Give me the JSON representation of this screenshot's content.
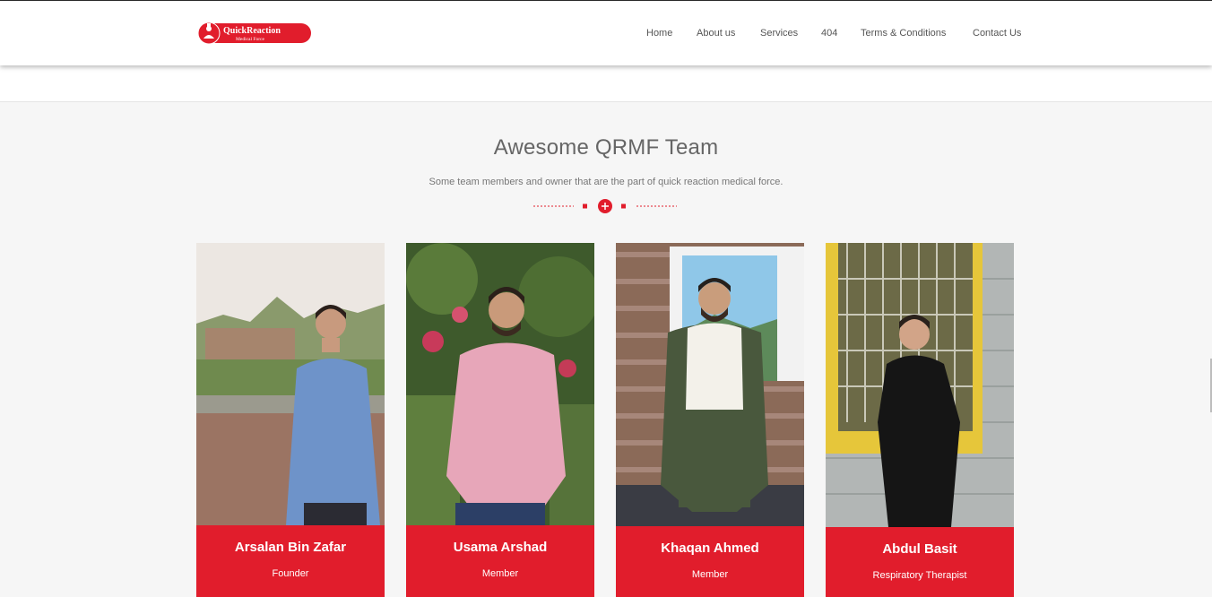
{
  "brand": {
    "logo_text_top": "QuickReaction",
    "logo_text_bottom": "Medical Force",
    "logo_icon": "medical-cross-people-icon",
    "accent": "#e11d2c"
  },
  "nav": {
    "items": [
      {
        "label": "Home"
      },
      {
        "label": "About us"
      },
      {
        "label": "Services"
      },
      {
        "label": "404"
      },
      {
        "label": "Terms & Conditions"
      },
      {
        "label": "Contact Us"
      }
    ]
  },
  "team": {
    "title": "Awesome QRMF Team",
    "subtitle": "Some team members and owner that are the part of quick reaction medical force.",
    "divider_icon": "plus-icon",
    "members": [
      {
        "name": "Arsalan Bin Zafar",
        "role": "Founder",
        "photo": "person-photo-blue-shirt-river"
      },
      {
        "name": "Usama Arshad",
        "role": "Member",
        "photo": "person-photo-pink-shirt-garden"
      },
      {
        "name": "Khaqan Ahmed",
        "role": "Member",
        "photo": "person-photo-waistcoat-brick-wall"
      },
      {
        "name": "Abdul Basit",
        "role": "Respiratory Therapist",
        "photo": "person-photo-black-kurta-window"
      }
    ]
  }
}
